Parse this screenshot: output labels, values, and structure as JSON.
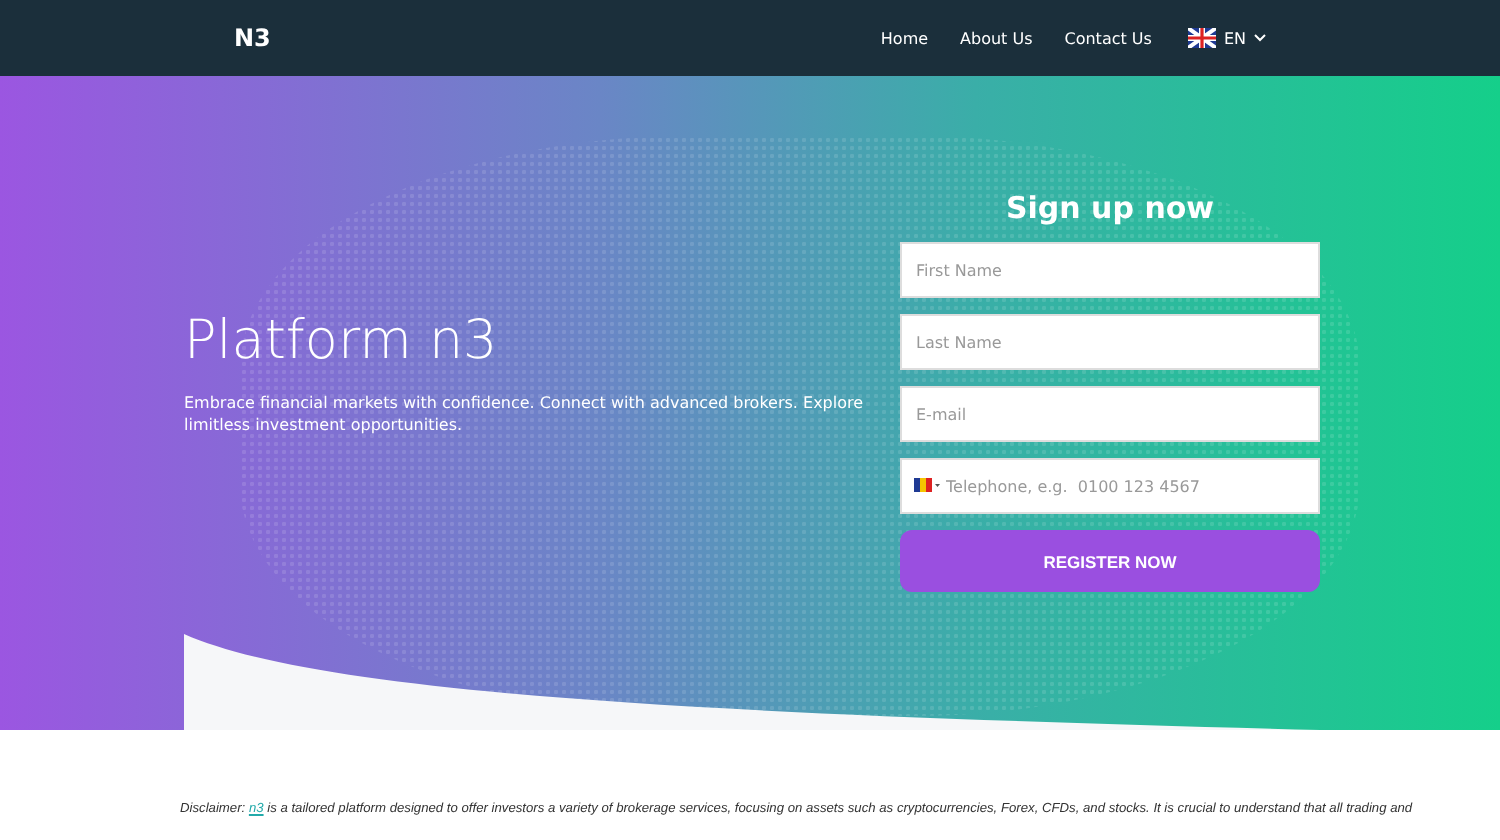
{
  "nav": {
    "logo": "N3",
    "links": [
      "Home",
      "About Us",
      "Contact Us"
    ],
    "language": "EN"
  },
  "hero": {
    "title": "Platform n3",
    "subtitle": "Embrace financial markets with confidence. Connect with advanced brokers. Explore limitless investment opportunities."
  },
  "signup": {
    "title": "Sign up now",
    "fields": [
      {
        "placeholder": "First Name",
        "kind": "text"
      },
      {
        "placeholder": "Last Name",
        "kind": "text"
      },
      {
        "placeholder": "E-mail",
        "kind": "text"
      },
      {
        "placeholder": "Telephone, e.g.  0100 123 4567",
        "kind": "phone"
      }
    ],
    "button": "REGISTER NOW"
  },
  "disclaimer": {
    "lead": "Disclaimer: ",
    "link": "n3",
    "text": " is a tailored platform designed to offer investors a variety of brokerage services, focusing on assets such as cryptocurrencies, Forex, CFDs, and stocks. It is crucial to understand that all trading and"
  }
}
